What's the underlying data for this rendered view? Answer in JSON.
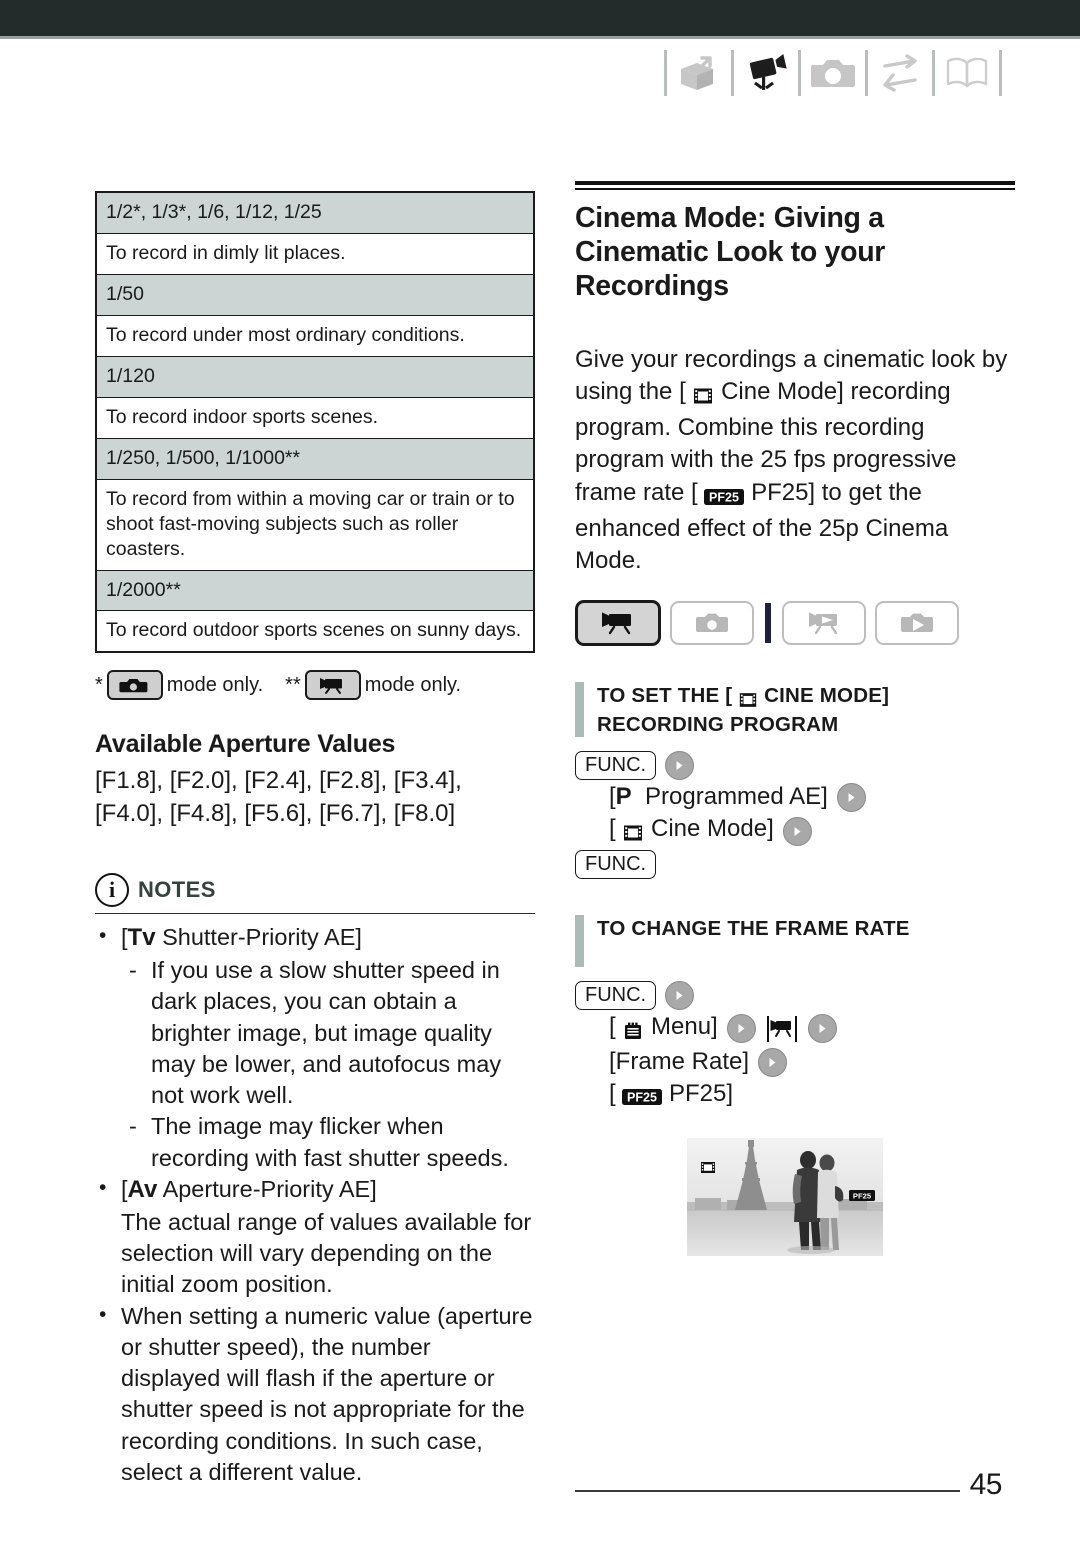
{
  "page": {
    "number": "45"
  },
  "header": {
    "icons": [
      {
        "name": "box-intro-icon",
        "label": "Introduction"
      },
      {
        "name": "camcorder-icon",
        "label": "Video"
      },
      {
        "name": "photo-camera-icon",
        "label": "Photos"
      },
      {
        "name": "exchange-arrows-icon",
        "label": "External Connections"
      },
      {
        "name": "open-book-icon",
        "label": "Additional Information"
      }
    ]
  },
  "left_column": {
    "shutter_table": {
      "rows": [
        {
          "speed": "1/2*, 1/3*, 1/6, 1/12, 1/25",
          "description": "To record in dimly lit places."
        },
        {
          "speed": "1/50",
          "description": "To record under most ordinary conditions."
        },
        {
          "speed": "1/120",
          "description": "To record indoor sports scenes."
        },
        {
          "speed": "1/250, 1/500, 1/1000**",
          "description": "To record from within a moving car or train or to shoot fast-moving subjects such as roller coasters."
        },
        {
          "speed": "1/2000**",
          "description": "To record outdoor sports scenes on sunny days."
        }
      ]
    },
    "footnote": {
      "single_star": "*",
      "single_star_icon": "photo-camera-mode-icon",
      "single_star_text": "mode only.",
      "double_star": "**",
      "double_star_icon": "camcorder-mode-icon",
      "double_star_text": "mode only."
    },
    "aperture": {
      "heading": "Available Aperture Values",
      "values": "[F1.8], [F2.0], [F2.4], [F2.8], [F3.4], [F4.0], [F4.8], [F5.6], [F6.7], [F8.0]"
    },
    "notes": {
      "title": "NOTES",
      "items": [
        {
          "badge": "Tv",
          "label_open": "[",
          "label": "Shutter-Priority AE]",
          "subitems": [
            "If you use a slow shutter speed in dark places, you can obtain a brighter image, but image quality may be lower, and autofocus may not work well.",
            "The image may flicker when recording with fast shutter speeds."
          ]
        },
        {
          "badge": "Av",
          "label_open": "[",
          "label": "Aperture-Priority AE]",
          "body": "The actual range of values available for selection will vary depending on the initial zoom position."
        },
        {
          "body": "When setting a numeric value (aperture or shutter speed), the number displayed will flash if the aperture or shutter speed is not appropriate for the recording conditions. In such case, select a different value."
        }
      ]
    }
  },
  "right_column": {
    "chapter_title": "Cinema Mode: Giving a Cinematic Look to your Recordings",
    "intro": {
      "part1": "Give your recordings a cinematic look by using the [",
      "cine_icon": "cine-mode-icon",
      "part2": "Cine Mode] recording program. Combine this recording program with the 25 fps progressive frame rate [",
      "pf25_badge": "PF25",
      "part3": "PF25] to get the enhanced effect of the 25p Cinema Mode."
    },
    "mode_buttons": [
      {
        "name": "mode-camcorder",
        "active": true
      },
      {
        "name": "mode-photo-camera",
        "active": false
      },
      {
        "name": "mode-playback-video",
        "active": false
      },
      {
        "name": "mode-playback-photo",
        "active": false
      }
    ],
    "section_set_cine": {
      "heading_before": "To set the [",
      "heading_icon": "cine-mode-icon",
      "heading_after": "Cine Mode] recording program",
      "steps": [
        {
          "type": "func",
          "label": "FUNC.",
          "arrow": true
        },
        {
          "type": "option",
          "badge": "P",
          "label": "Programmed AE]",
          "open": "[",
          "arrow": true
        },
        {
          "type": "option",
          "icon": "cine-mode-icon",
          "label": "Cine Mode]",
          "open": "[",
          "arrow": true
        },
        {
          "type": "func",
          "label": "FUNC.",
          "arrow": false
        }
      ]
    },
    "section_frame_rate": {
      "heading": "To change the frame rate",
      "steps": [
        {
          "type": "func",
          "label": "FUNC.",
          "arrow": true
        },
        {
          "type": "menu",
          "icon": "menu-icon",
          "label": "Menu]",
          "open": "[",
          "arrow": true,
          "second_icon": "camcorder-tab-icon",
          "second_arrow": true
        },
        {
          "type": "option",
          "label": "[Frame Rate]",
          "arrow": true
        },
        {
          "type": "option",
          "open": "[",
          "badge": "PF25",
          "label": "PF25]",
          "arrow": false
        }
      ]
    },
    "photo": {
      "name": "eiffel-tower-couple-photo",
      "overlay_cine": "cine-mode-icon",
      "overlay_pf25": "PF25"
    }
  }
}
